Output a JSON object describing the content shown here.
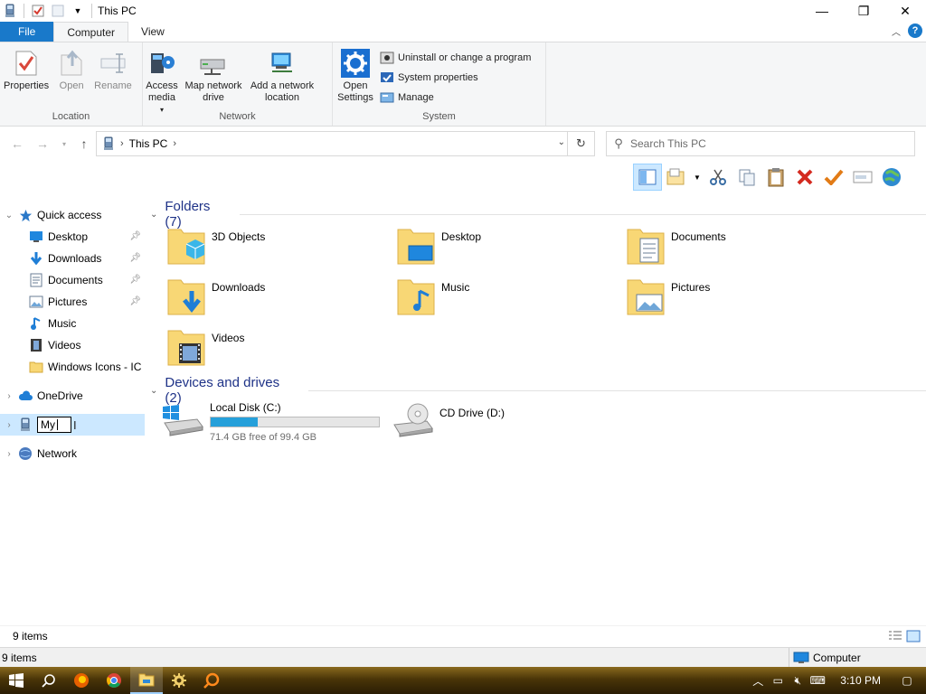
{
  "window": {
    "title": "This PC"
  },
  "tabs": {
    "file": "File",
    "computer": "Computer",
    "view": "View"
  },
  "ribbon": {
    "location": {
      "label": "Location",
      "properties": "Properties",
      "open": "Open",
      "rename": "Rename"
    },
    "network": {
      "label": "Network",
      "access_media": "Access media",
      "map_drive": "Map network drive",
      "add_location": "Add a network location"
    },
    "system": {
      "label": "System",
      "open_settings": "Open Settings",
      "uninstall": "Uninstall or change a program",
      "system_properties": "System properties",
      "manage": "Manage"
    }
  },
  "address": {
    "crumb": "This PC",
    "search_placeholder": "Search This PC"
  },
  "nav": {
    "quick_access": "Quick access",
    "items": [
      {
        "label": "Desktop",
        "pinned": true
      },
      {
        "label": "Downloads",
        "pinned": true
      },
      {
        "label": "Documents",
        "pinned": true
      },
      {
        "label": "Pictures",
        "pinned": true
      },
      {
        "label": "Music",
        "pinned": false
      },
      {
        "label": "Videos",
        "pinned": false
      },
      {
        "label": "Windows Icons - IC",
        "pinned": false
      }
    ],
    "onedrive": "OneDrive",
    "rename_value": "My",
    "network": "Network"
  },
  "folders": {
    "heading": "Folders (7)",
    "items": [
      "3D Objects",
      "Desktop",
      "Documents",
      "Downloads",
      "Music",
      "Pictures",
      "Videos"
    ]
  },
  "drives": {
    "heading": "Devices and drives (2)",
    "items": [
      {
        "name": "Local Disk (C:)",
        "free": "71.4 GB free of 99.4 GB",
        "used_fraction": 0.28
      },
      {
        "name": "CD Drive (D:)"
      }
    ]
  },
  "status": {
    "items": "9 items",
    "items2": "9 items",
    "zone": "Computer"
  },
  "taskbar": {
    "time": "3:10 PM"
  },
  "colors": {
    "accent": "#1979ca",
    "bar": "#26a0da",
    "section": "#1e3287"
  }
}
